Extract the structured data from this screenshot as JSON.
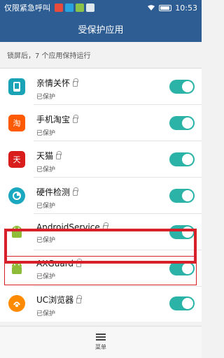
{
  "statusbar": {
    "carrier": "仅限紧急呼叫",
    "time": "10:53",
    "icons": [
      "notification-icon-1",
      "notification-icon-2",
      "notification-icon-3",
      "sim-icon"
    ]
  },
  "title": "受保护应用",
  "hint": "锁屏后，7 个应用保持运行",
  "apps": [
    {
      "name": "亲情关怀",
      "status": "已保护",
      "icon": "phone-icon",
      "color": "#1aa3b7",
      "top": 0
    },
    {
      "name": "手机淘宝",
      "status": "已保护",
      "icon": "taobao-icon",
      "color": "#ff5a00",
      "top": 0
    },
    {
      "name": "天猫",
      "status": "已保护",
      "icon": "tmall-icon",
      "color": "#d91c1c",
      "top": 0
    },
    {
      "name": "硬件检测",
      "status": "已保护",
      "icon": "hardware-icon",
      "color": "#19a8c0",
      "top": 0
    },
    {
      "name": "AndroidService",
      "status": "已保护",
      "icon": "android-icon",
      "color": "#8fbd3a",
      "top": 0
    },
    {
      "name": "AXGuard",
      "status": "已保护",
      "icon": "android-icon",
      "color": "#8fbd3a",
      "top": 0
    },
    {
      "name": "UC浏览器",
      "status": "已保护",
      "icon": "uc-icon",
      "color": "#ff8a00",
      "top": 0
    }
  ],
  "bottom": {
    "menu_label": "菜单"
  }
}
